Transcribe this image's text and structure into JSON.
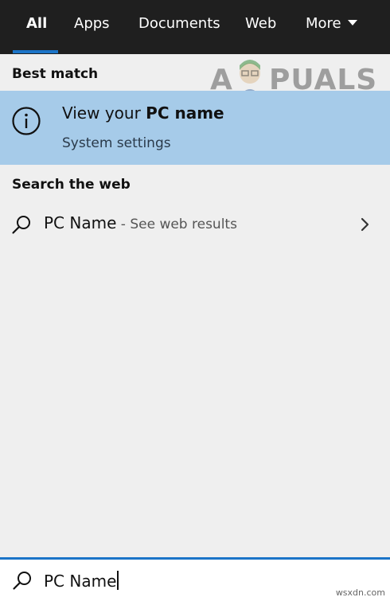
{
  "tabs": [
    {
      "label": "All",
      "active": true
    },
    {
      "label": "Apps"
    },
    {
      "label": "Documents"
    },
    {
      "label": "Web"
    },
    {
      "label": "More"
    }
  ],
  "best_match": {
    "heading": "Best match",
    "title_prefix": "View your ",
    "title_bold": "PC name",
    "subtitle": "System settings",
    "icon": "info-icon"
  },
  "web": {
    "heading": "Search the web",
    "query": "PC Name",
    "suffix": " - See web results",
    "icon": "search-icon"
  },
  "search_box": {
    "value": "PC Name",
    "icon": "search-icon"
  },
  "watermark": {
    "left": "A",
    "right": "PUALS"
  },
  "footer": "wsxdn.com",
  "colors": {
    "topbar": "#1f1f1f",
    "accent": "#1b74c8",
    "highlight": "#a6cbe9",
    "background": "#efefef"
  }
}
